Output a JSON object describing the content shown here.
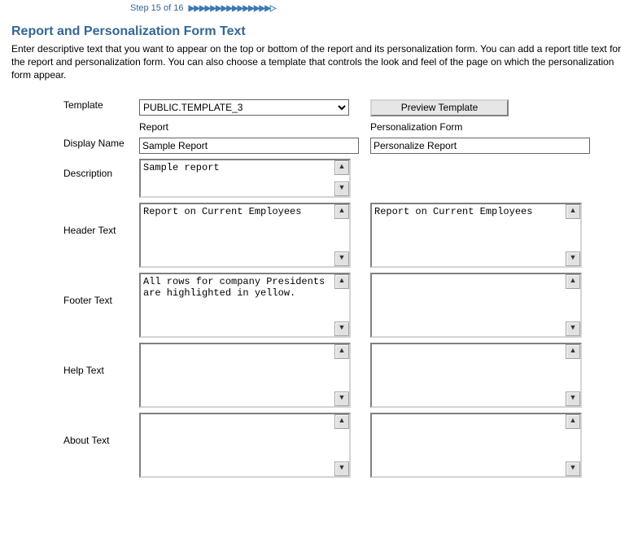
{
  "step": {
    "text": "Step 15 of 16"
  },
  "title": "Report and Personalization Form Text",
  "intro": "Enter descriptive text that you want to appear on the top or bottom of the report and its personalization form. You can add a report title text for the report and personalization form. You can also choose a template that controls the look and feel of the page on which the personalization form appear.",
  "labels": {
    "template": "Template",
    "displayName": "Display Name",
    "description": "Description",
    "headerText": "Header Text",
    "footerText": "Footer Text",
    "helpText": "Help Text",
    "aboutText": "About Text"
  },
  "columns": {
    "report": "Report",
    "pers": "Personalization Form"
  },
  "template": {
    "selected": "PUBLIC.TEMPLATE_3",
    "previewBtn": "Preview Template"
  },
  "report": {
    "displayName": "Sample Report",
    "description": "Sample report",
    "header": "Report on Current Employees",
    "footer": "All rows for company Presidents are highlighted in yellow.",
    "help": "",
    "about": ""
  },
  "pers": {
    "displayName": "Personalize Report",
    "header": "Report on Current Employees",
    "footer": "",
    "help": "",
    "about": ""
  }
}
